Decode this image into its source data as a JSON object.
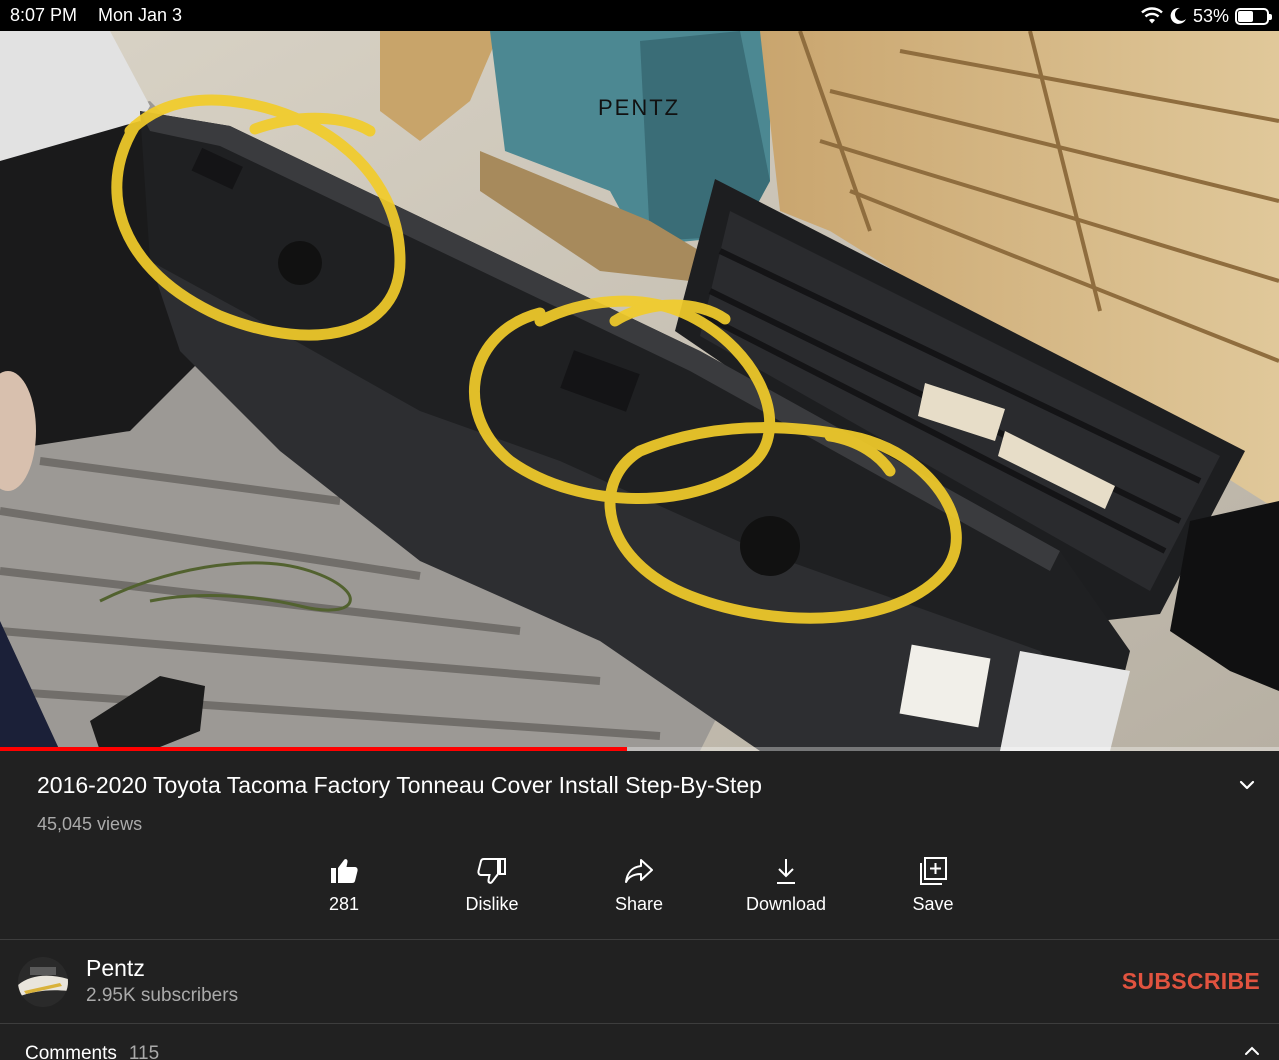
{
  "status_bar": {
    "time": "8:07 PM",
    "date": "Mon Jan 3",
    "battery_percent": "53%",
    "battery_level": 0.53,
    "icons": [
      "wifi-icon",
      "moon-icon",
      "battery-icon"
    ]
  },
  "video": {
    "watermark": "PENTZ",
    "progress": 0.49,
    "title": "2016-2020 Toyota Tacoma Factory Tonneau Cover Install Step-By-Step",
    "views": "45,045 views",
    "expand_icon": "chevron-down-icon"
  },
  "actions": [
    {
      "label": "281",
      "icon": "thumbs-up-icon"
    },
    {
      "label": "Dislike",
      "icon": "thumbs-down-icon"
    },
    {
      "label": "Share",
      "icon": "share-icon"
    },
    {
      "label": "Download",
      "icon": "download-icon"
    },
    {
      "label": "Save",
      "icon": "add-to-playlist-icon"
    }
  ],
  "channel": {
    "name": "Pentz",
    "subscribers": "2.95K subscribers",
    "subscribe_label": "SUBSCRIBE",
    "subscribe_color": "#e1533f"
  },
  "comments": {
    "label": "Comments",
    "count": "115",
    "toggle_icon": "chevron-up-icon"
  },
  "colors": {
    "background": "#212121",
    "progress": "#ff0000",
    "highlight_marker": "#f2cc2a"
  }
}
